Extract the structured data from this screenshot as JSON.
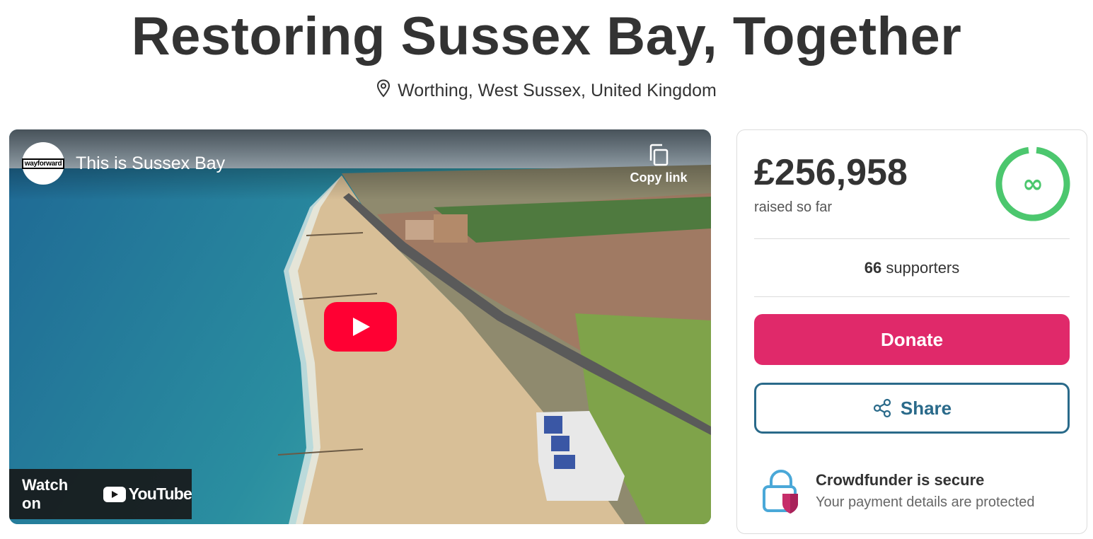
{
  "page": {
    "title": "Restoring Sussex Bay, Together",
    "location": "Worthing, West Sussex, United Kingdom"
  },
  "video": {
    "channel_logo_text": "wayforward",
    "title": "This is Sussex Bay",
    "copy_link_label": "Copy link",
    "watch_on_label": "Watch on",
    "youtube_wordmark": "YouTube"
  },
  "funding": {
    "amount": "£256,958",
    "amount_label": "raised so far",
    "supporters_count": "66",
    "supporters_label": " supporters",
    "progress_ring_symbol": "∞"
  },
  "actions": {
    "donate_label": "Donate",
    "share_label": "Share"
  },
  "security": {
    "title": "Crowdfunder is secure",
    "subtitle": "Your payment details are protected"
  },
  "icons": [
    "location-pin-icon",
    "copy-icon",
    "play-icon",
    "youtube-icon",
    "share-icon",
    "padlock-shield-icon",
    "infinity-icon"
  ],
  "colors": {
    "donate": "#e0296a",
    "share": "#2a6a8a",
    "progress_ring": "#4cc76e",
    "youtube_red": "#ff0033"
  }
}
